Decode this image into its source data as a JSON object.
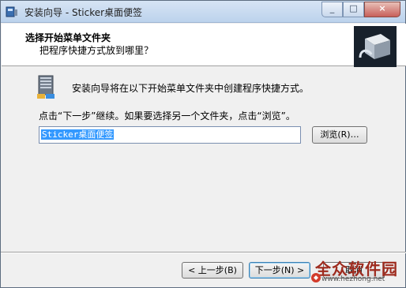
{
  "window": {
    "title": "安装向导 - Sticker桌面便签",
    "controls": {
      "minimize": "_",
      "maximize": "□",
      "close": "×"
    }
  },
  "header": {
    "title": "选择开始菜单文件夹",
    "subtitle": "把程序快捷方式放到哪里？",
    "image_icon": "installer-box-icon"
  },
  "content": {
    "intro": "安装向导将在以下开始菜单文件夹中创建程序快捷方式。",
    "instruction": "点击“下一步”继续。如果要选择另一个文件夹，点击“浏览”。",
    "folder_value": "Sticker桌面便签",
    "browse_label": "浏览(R)…"
  },
  "buttons": {
    "back": "< 上一步(B)",
    "next": "下一步(N) >",
    "cancel": "取消"
  },
  "watermark": {
    "text": "全众软件园",
    "url": "www.hezhong.net"
  },
  "colors": {
    "titlebar": "#c8daf0",
    "selection": "#3399ff",
    "watermark": "#9e2b1e"
  }
}
